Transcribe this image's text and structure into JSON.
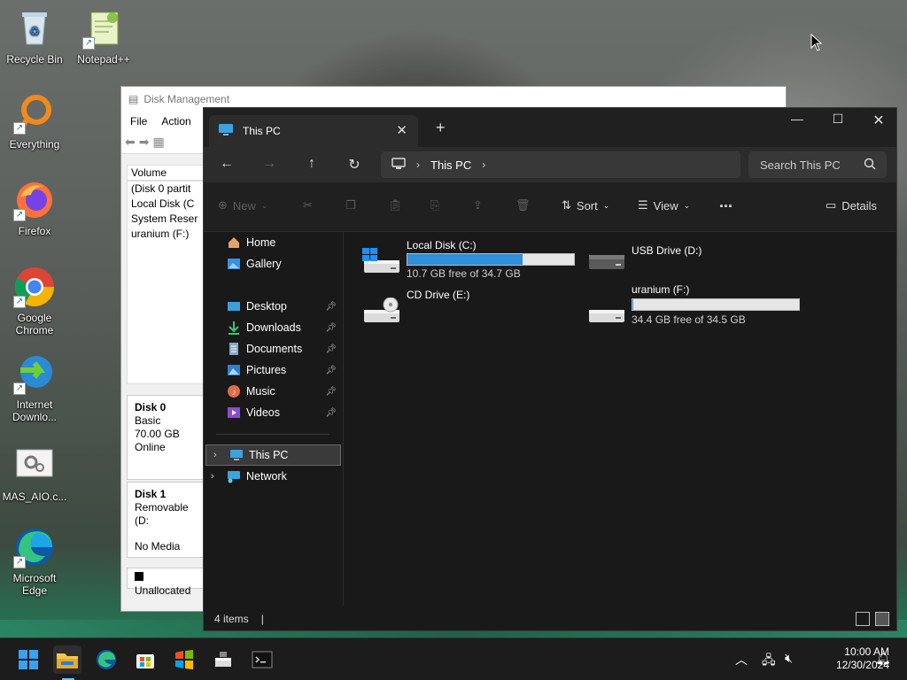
{
  "desktop": {
    "icons": [
      {
        "label": "Recycle Bin"
      },
      {
        "label": "Notepad++"
      },
      {
        "label": "Everything"
      },
      {
        "label": "Firefox"
      },
      {
        "label": "Google Chrome"
      },
      {
        "label": "Internet Downlo..."
      },
      {
        "label": "MAS_AIO.c..."
      },
      {
        "label": "Microsoft Edge"
      }
    ]
  },
  "disk_management": {
    "title": "Disk Management",
    "menu": [
      "File",
      "Action"
    ],
    "volume_header": "Volume",
    "volumes": [
      "(Disk 0 partit",
      "Local Disk (C",
      "System Reser",
      "uranium (F:)"
    ],
    "disk0": {
      "name": "Disk 0",
      "type": "Basic",
      "size": "70.00 GB",
      "status": "Online"
    },
    "disk1": {
      "name": "Disk 1",
      "type": "Removable (D:",
      "status": "No Media"
    },
    "legend": "Unallocated"
  },
  "explorer": {
    "tab_title": "This PC",
    "breadcrumb": "This PC",
    "search_placeholder": "Search This PC",
    "commands": {
      "new": "New",
      "sort": "Sort",
      "view": "View",
      "more": "...",
      "details": "Details"
    },
    "nav": {
      "home": "Home",
      "gallery": "Gallery",
      "desktop": "Desktop",
      "downloads": "Downloads",
      "documents": "Documents",
      "pictures": "Pictures",
      "music": "Music",
      "videos": "Videos",
      "this_pc": "This PC",
      "network": "Network"
    },
    "drives": [
      {
        "name": "Local Disk (C:)",
        "free": "10.7 GB free of 34.7 GB",
        "used_fraction": 0.69,
        "icon": "windows-drive-icon"
      },
      {
        "name": "USB Drive (D:)",
        "icon": "usb-drive-icon"
      },
      {
        "name": "CD Drive (E:)",
        "icon": "cd-drive-icon"
      },
      {
        "name": "uranium (F:)",
        "free": "34.4 GB free of 34.5 GB",
        "used_fraction": 0.003,
        "icon": "hard-drive-icon"
      }
    ],
    "status": "4 items"
  },
  "taskbar": {
    "time": "10:00 AM",
    "date": "12/30/2024"
  },
  "colors": {
    "accent": "#2f8fd8",
    "explorer_bg": "#191919",
    "taskbar_bg": "#1c1c1c"
  }
}
